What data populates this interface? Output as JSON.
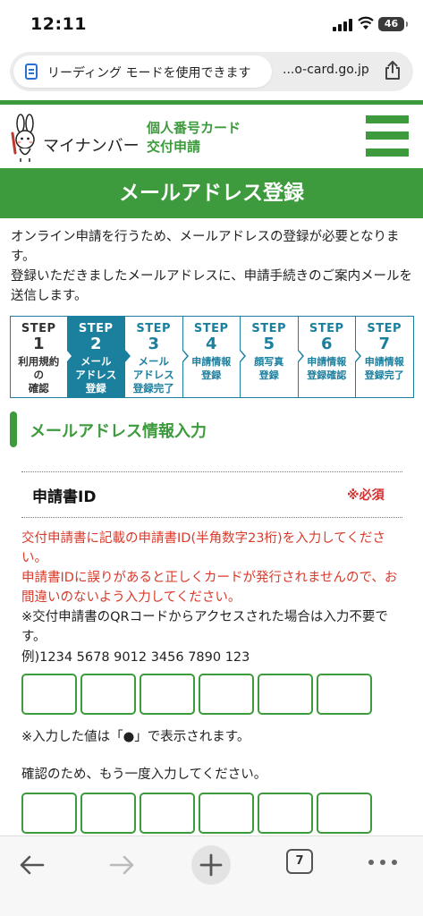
{
  "status": {
    "time": "12:11",
    "battery": "46"
  },
  "browser": {
    "reader_label": "リーディング モードを使用できます",
    "url": "...o-card.go.jp",
    "tab_count": "7",
    "icons": [
      "reader-icon",
      "share-icon",
      "back-arrow-icon",
      "forward-arrow-icon",
      "plus-icon",
      "tabs-icon",
      "more-icon"
    ]
  },
  "header": {
    "logo_text": "マイナンバー",
    "card_line1": "個人番号カード",
    "card_line2": "交付申請",
    "accent": "#3d9b3d"
  },
  "page": {
    "title": "メールアドレス登録",
    "intro1": "オンライン申請を行うため、メールアドレスの登録が必要となります。",
    "intro2": "登録いただきましたメールアドレスに、申請手続きのご案内メールを送信します。"
  },
  "steps": [
    {
      "label": "STEP",
      "num": "1",
      "desc_lines": [
        "利用規約",
        "の",
        "確認"
      ]
    },
    {
      "label": "STEP",
      "num": "2",
      "desc_lines": [
        "メール",
        "アドレス",
        "登録"
      ]
    },
    {
      "label": "STEP",
      "num": "3",
      "desc_lines": [
        "メール",
        "アドレス",
        "登録完了"
      ]
    },
    {
      "label": "STEP",
      "num": "4",
      "desc_lines": [
        "申請情報",
        "登録"
      ]
    },
    {
      "label": "STEP",
      "num": "5",
      "desc_lines": [
        "顔写真",
        "登録"
      ]
    },
    {
      "label": "STEP",
      "num": "6",
      "desc_lines": [
        "申請情報",
        "登録確認"
      ]
    },
    {
      "label": "STEP",
      "num": "7",
      "desc_lines": [
        "申請情報",
        "登録完了"
      ]
    }
  ],
  "section": {
    "title": "メールアドレス情報入力"
  },
  "field": {
    "label": "申請書ID",
    "required": "※必須",
    "red_note1": "交付申請書に記載の申請書ID(半角数字23桁)を入力してください。",
    "red_note2": "申請書IDに誤りがあると正しくカードが発行されませんので、お間違いのないよう入力してください。",
    "qr_note": "※交付申請書のQRコードからアクセスされた場合は入力不要です。",
    "example": "例)1234 5678 9012 3456 7890 123",
    "mask_note": "※入力した値は「●」で表示されます。",
    "confirm_note": "確認のため、もう一度入力してください。"
  }
}
